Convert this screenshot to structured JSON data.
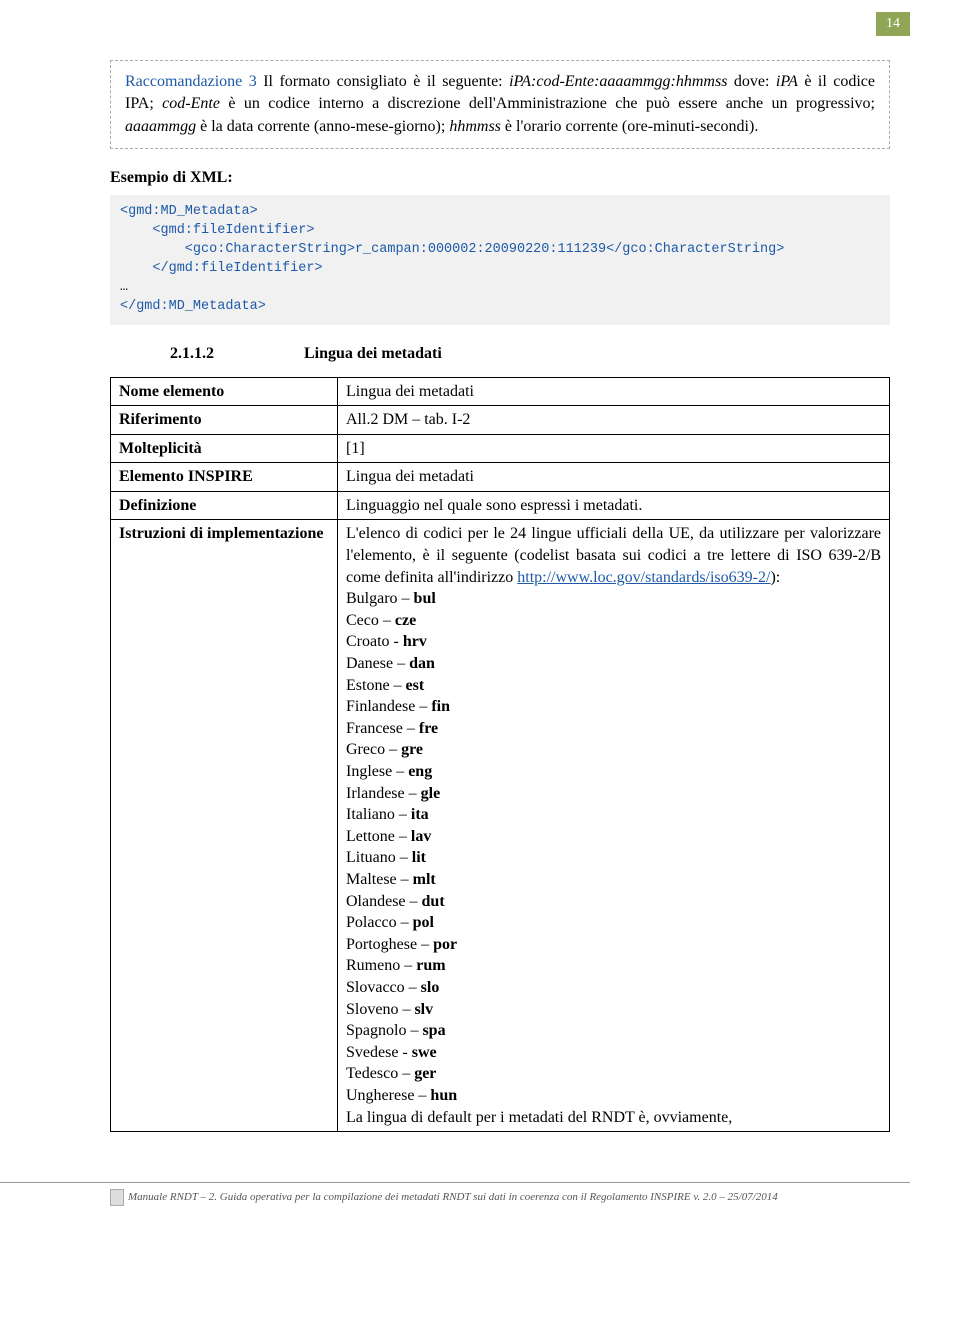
{
  "page_number": "14",
  "recommendation": {
    "label": "Raccomandazione 3",
    "text_parts": {
      "p1": " Il formato consigliato è il seguente: ",
      "fmt": "iPA:cod-Ente:aaaammgg:hhmmss",
      "p2": " dove: ",
      "ipa": "iPA",
      "p3": " è il codice IPA; ",
      "codente": "cod-Ente",
      "p4": " è un codice interno a discrezione dell'Amministrazione che può essere anche un progressivo; ",
      "date": "aaaammgg",
      "p5": " è la data corrente (anno-mese-giorno); ",
      "time": "hhmmss",
      "p6": " è l'orario corrente (ore-minuti-secondi)."
    }
  },
  "xml_example_title": "Esempio di XML:",
  "xml_code": {
    "l1": "<gmd:MD_Metadata>",
    "l2": "    <gmd:fileIdentifier>",
    "l3": "        <gco:CharacterString>r_campan:000002:20090220:111239</gco:CharacterString>",
    "l4": "    </gmd:fileIdentifier>",
    "ld": "…",
    "l5": "</gmd:MD_Metadata>"
  },
  "subheading": {
    "num": "2.1.1.2",
    "title": "Lingua dei metadati"
  },
  "table": {
    "rows": {
      "r1_label": "Nome elemento",
      "r1_val": "Lingua dei metadati",
      "r2_label": "Riferimento",
      "r2_val": "All.2 DM – tab. I-2",
      "r3_label": "Molteplicità",
      "r3_val": "[1]",
      "r4_label": "Elemento INSPIRE",
      "r4_val": "Lingua dei metadati",
      "r5_label": "Definizione",
      "r5_val": "Linguaggio nel quale sono espressi i metadati.",
      "r6_label": "Istruzioni di implementazione"
    },
    "instructions": {
      "intro1": "L'elenco di codici per le 24 lingue ufficiali della UE, da utilizzare per valorizzare l'elemento, è il seguente (codelist basata sui codici a tre lettere di ISO 639-2/B come definita all'indirizzo ",
      "link": "http://www.loc.gov/standards/iso639-2/",
      "intro2": "):",
      "langs": [
        {
          "name": "Bulgaro",
          "sep": " – ",
          "code": "bul"
        },
        {
          "name": "Ceco",
          "sep": " – ",
          "code": "cze"
        },
        {
          "name": "Croato",
          "sep": " - ",
          "code": "hrv"
        },
        {
          "name": "Danese",
          "sep": " – ",
          "code": "dan"
        },
        {
          "name": "Estone",
          "sep": " – ",
          "code": "est"
        },
        {
          "name": "Finlandese",
          "sep": " – ",
          "code": "fin"
        },
        {
          "name": "Francese",
          "sep": " – ",
          "code": "fre"
        },
        {
          "name": "Greco",
          "sep": " – ",
          "code": "gre"
        },
        {
          "name": "Inglese",
          "sep": " – ",
          "code": "eng"
        },
        {
          "name": "Irlandese",
          "sep": " – ",
          "code": "gle"
        },
        {
          "name": "Italiano",
          "sep": " – ",
          "code": "ita"
        },
        {
          "name": "Lettone",
          "sep": " – ",
          "code": "lav"
        },
        {
          "name": "Lituano",
          "sep": " – ",
          "code": "lit"
        },
        {
          "name": "Maltese",
          "sep": " – ",
          "code": "mlt"
        },
        {
          "name": "Olandese",
          "sep": " – ",
          "code": "dut"
        },
        {
          "name": "Polacco",
          "sep": " – ",
          "code": "pol"
        },
        {
          "name": "Portoghese",
          "sep": " – ",
          "code": "por"
        },
        {
          "name": "Rumeno",
          "sep": " – ",
          "code": "rum"
        },
        {
          "name": "Slovacco",
          "sep": " – ",
          "code": "slo"
        },
        {
          "name": "Sloveno",
          "sep": " – ",
          "code": "slv"
        },
        {
          "name": "Spagnolo",
          "sep": " – ",
          "code": "spa"
        },
        {
          "name": "Svedese",
          "sep": " - ",
          "code": "swe"
        },
        {
          "name": "Tedesco",
          "sep": " – ",
          "code": "ger"
        },
        {
          "name": "Ungherese",
          "sep": " – ",
          "code": "hun"
        }
      ],
      "outro": "La lingua di default per i metadati del RNDT è, ovviamente,"
    }
  },
  "footer": "Manuale RNDT – 2. Guida operativa per la compilazione dei metadati RNDT sui dati in coerenza con il Regolamento INSPIRE   v. 2.0 – 25/07/2014"
}
